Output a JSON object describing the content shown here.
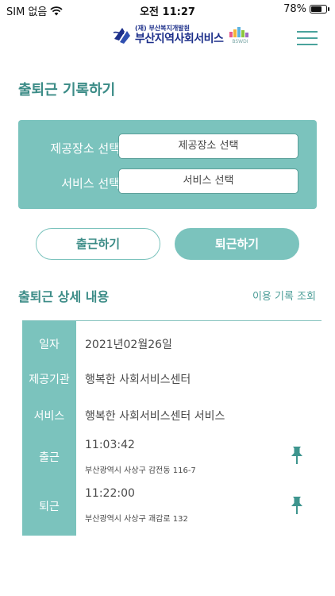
{
  "status_bar": {
    "carrier": "SIM 없음",
    "time": "오전 11:27",
    "battery_text": "78%",
    "battery_level": 0.78
  },
  "header": {
    "logo_small": "(재) 부산복지개발원",
    "logo_main": "부산지역사회서비스",
    "logo_side": "BSWDI",
    "menu_icon": "hamburger-icon"
  },
  "page_title": "출퇴근 기록하기",
  "select_panel": {
    "place_label": "제공장소 선택",
    "place_value": "제공장소 선택",
    "service_label": "서비스 선택",
    "service_value": "서비스 선택"
  },
  "buttons": {
    "check_in": "출근하기",
    "check_out": "퇴근하기"
  },
  "details": {
    "title": "출퇴근 상세 내용",
    "history_link": "이용 기록 조회",
    "date_label": "일자",
    "date_value": "2021년02월26일",
    "agency_label": "제공기관",
    "agency_value": "행복한 사회서비스센터",
    "service_label": "서비스",
    "service_value": "행복한 사회서비스센터 서비스",
    "in_label": "출근",
    "in_time": "11:03:42",
    "in_address": "부산광역시 사상구 감전동 116-7",
    "out_label": "퇴근",
    "out_time": "11:22:00",
    "out_address": "부산광역시 사상구 괘감로 132"
  },
  "colors": {
    "accent": "#7bc3bd",
    "accent_dark": "#3c8c87",
    "logo_blue": "#1c2f8a"
  }
}
